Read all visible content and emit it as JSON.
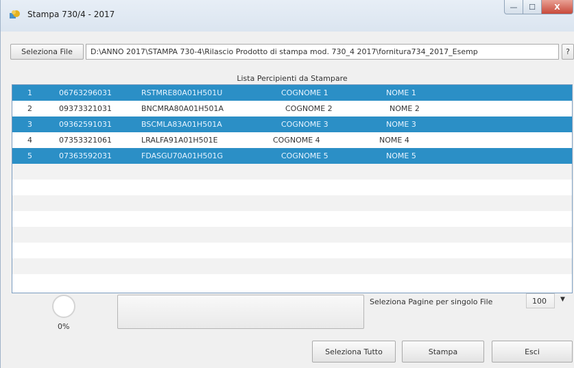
{
  "window": {
    "title": "Stampa 730/4 - 2017",
    "controls": {
      "minimize": "—",
      "maximize": "☐",
      "close": "X"
    }
  },
  "file": {
    "select_button": "Seleziona File",
    "path": "D:\\ANNO 2017\\STAMPA  730-4\\Rilascio Prodotto di stampa mod. 730_4 2017\\fornitura734_2017_Esemp",
    "help_button": "?"
  },
  "list": {
    "title": "Lista Percipienti da Stampare",
    "rows": [
      {
        "num": "1",
        "pid": "06763296031",
        "cf": "RSTMRE80A01H501U",
        "cognome": "COGNOME 1",
        "nome": "NOME 1",
        "selected": true
      },
      {
        "num": "2",
        "pid": "09373321031",
        "cf": "BNCMRA80A01H501A",
        "cognome": "COGNOME 2",
        "nome": "NOME 2",
        "selected": false
      },
      {
        "num": "3",
        "pid": "09362591031",
        "cf": "BSCMLA83A01H501A",
        "cognome": "COGNOME 3",
        "nome": "NOME 3",
        "selected": true
      },
      {
        "num": "4",
        "pid": "07353321061",
        "cf": "LRALFA91A01H501E",
        "cognome": "COGNOME 4",
        "nome": "NOME 4",
        "selected": false
      },
      {
        "num": "5",
        "pid": "07363592031",
        "cf": "FDASGU70A01H501G",
        "cognome": "COGNOME 5",
        "nome": "NOME 5",
        "selected": true
      }
    ]
  },
  "progress": {
    "percent_label": "0%"
  },
  "pages": {
    "label": "Seleziona Pagine per singolo File",
    "value": "100"
  },
  "buttons": {
    "select_all": "Seleziona Tutto",
    "print": "Stampa",
    "exit": "Esci"
  },
  "colors": {
    "selection": "#2b8fc6",
    "list_border": "#7a9cc0"
  }
}
